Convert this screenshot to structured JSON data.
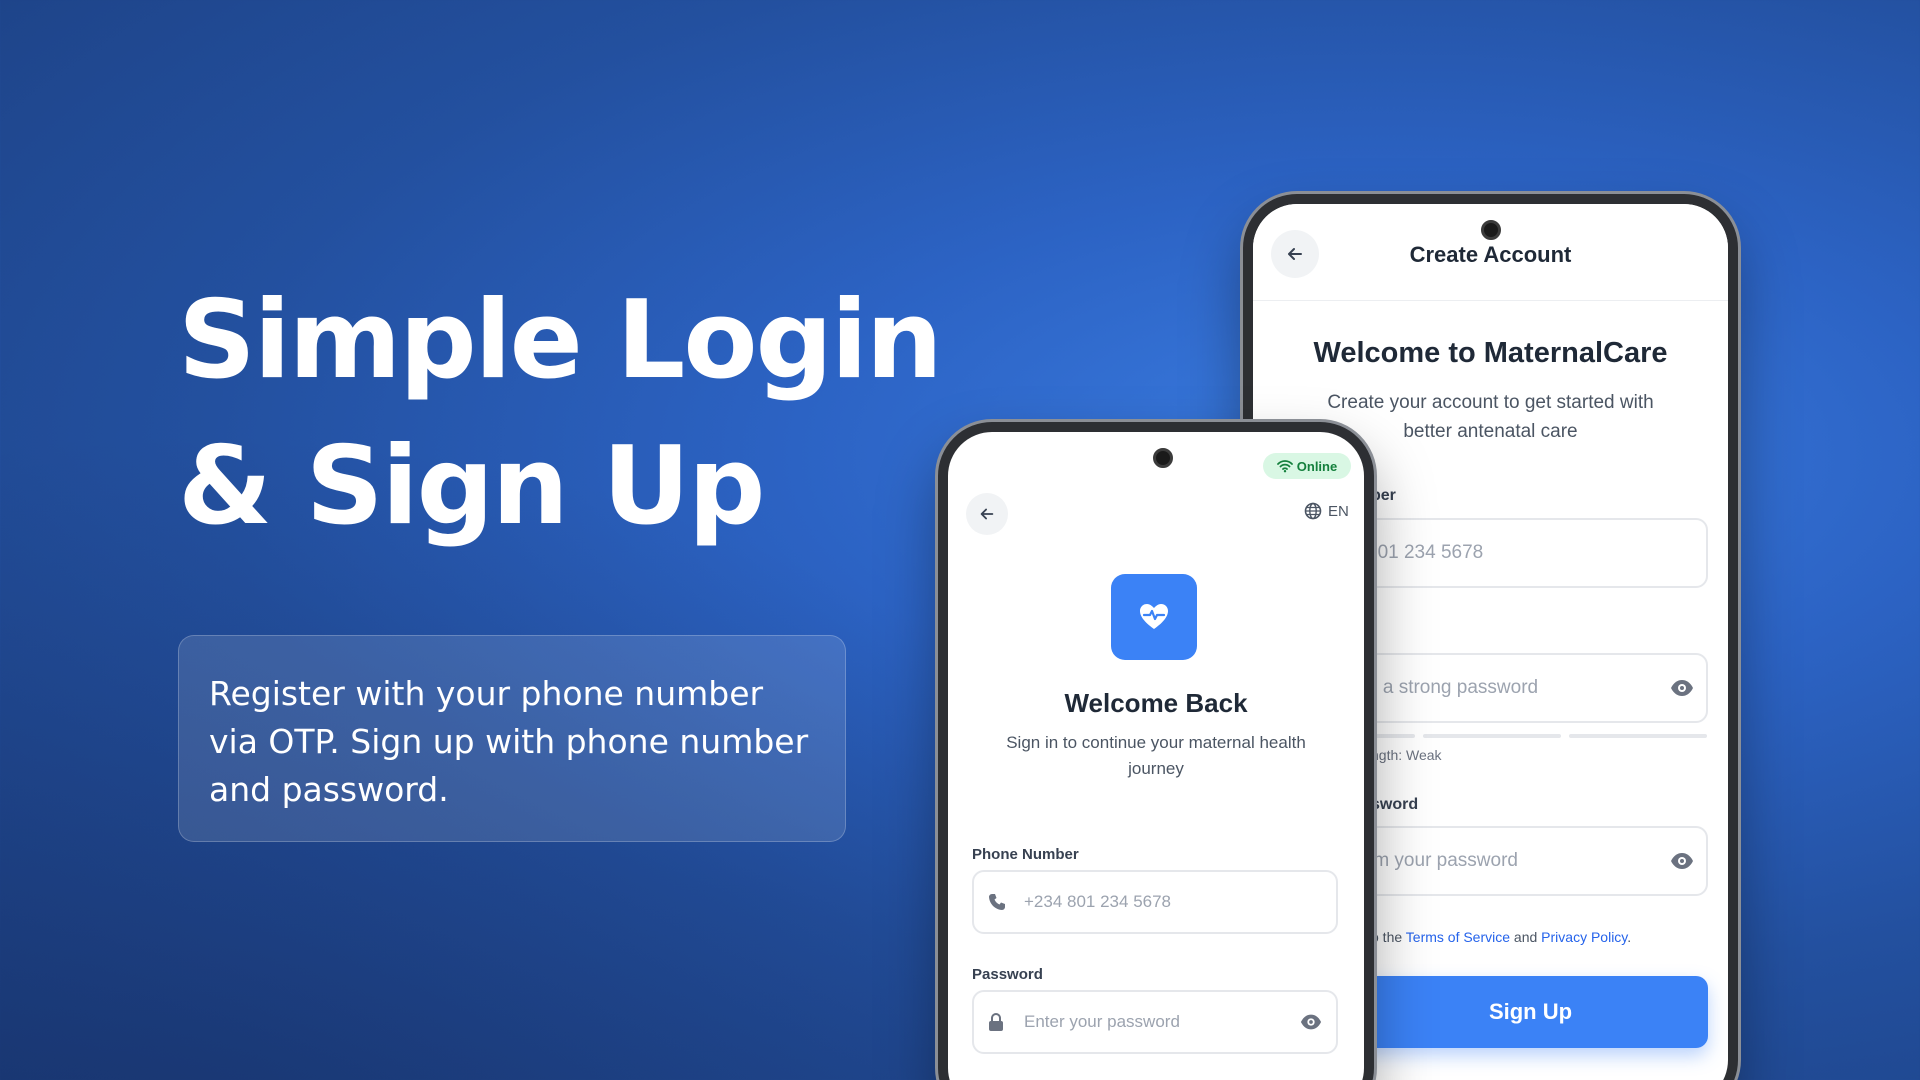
{
  "hero": {
    "title_line1": "Simple Login",
    "title_line2": "& Sign Up",
    "description": "Register with your phone number via OTP. Sign up with phone number and password."
  },
  "signup_screen": {
    "header_title": "Create Account",
    "heading": "Welcome to MaternalCare",
    "subheading": "Create your account to get started with better antenatal care",
    "phone_label": "ber",
    "phone_placeholder": "801 234 5678",
    "password_placeholder": "e a strong password",
    "strength_label": "ngth: Weak",
    "confirm_label": "sword",
    "confirm_placeholder": "rm your password",
    "terms_prefix": "o the ",
    "terms_link": "Terms of Service",
    "terms_and": " and ",
    "privacy_link": "Privacy Policy",
    "terms_suffix": ".",
    "signup_button": "Sign Up"
  },
  "login_screen": {
    "status_badge": "Online",
    "language": "EN",
    "heading": "Welcome Back",
    "subheading": "Sign in to continue your maternal health journey",
    "phone_label": "Phone Number",
    "phone_placeholder": "+234 801 234 5678",
    "password_label": "Password",
    "password_placeholder": "Enter your password"
  },
  "colors": {
    "primary": "#3b82f6",
    "background": "#2c63c4",
    "online_badge": "#d9f7e4"
  },
  "icons": [
    "back-arrow-icon",
    "eye-icon",
    "wifi-icon",
    "globe-icon",
    "heart-pulse-icon",
    "phone-icon",
    "lock-icon"
  ]
}
